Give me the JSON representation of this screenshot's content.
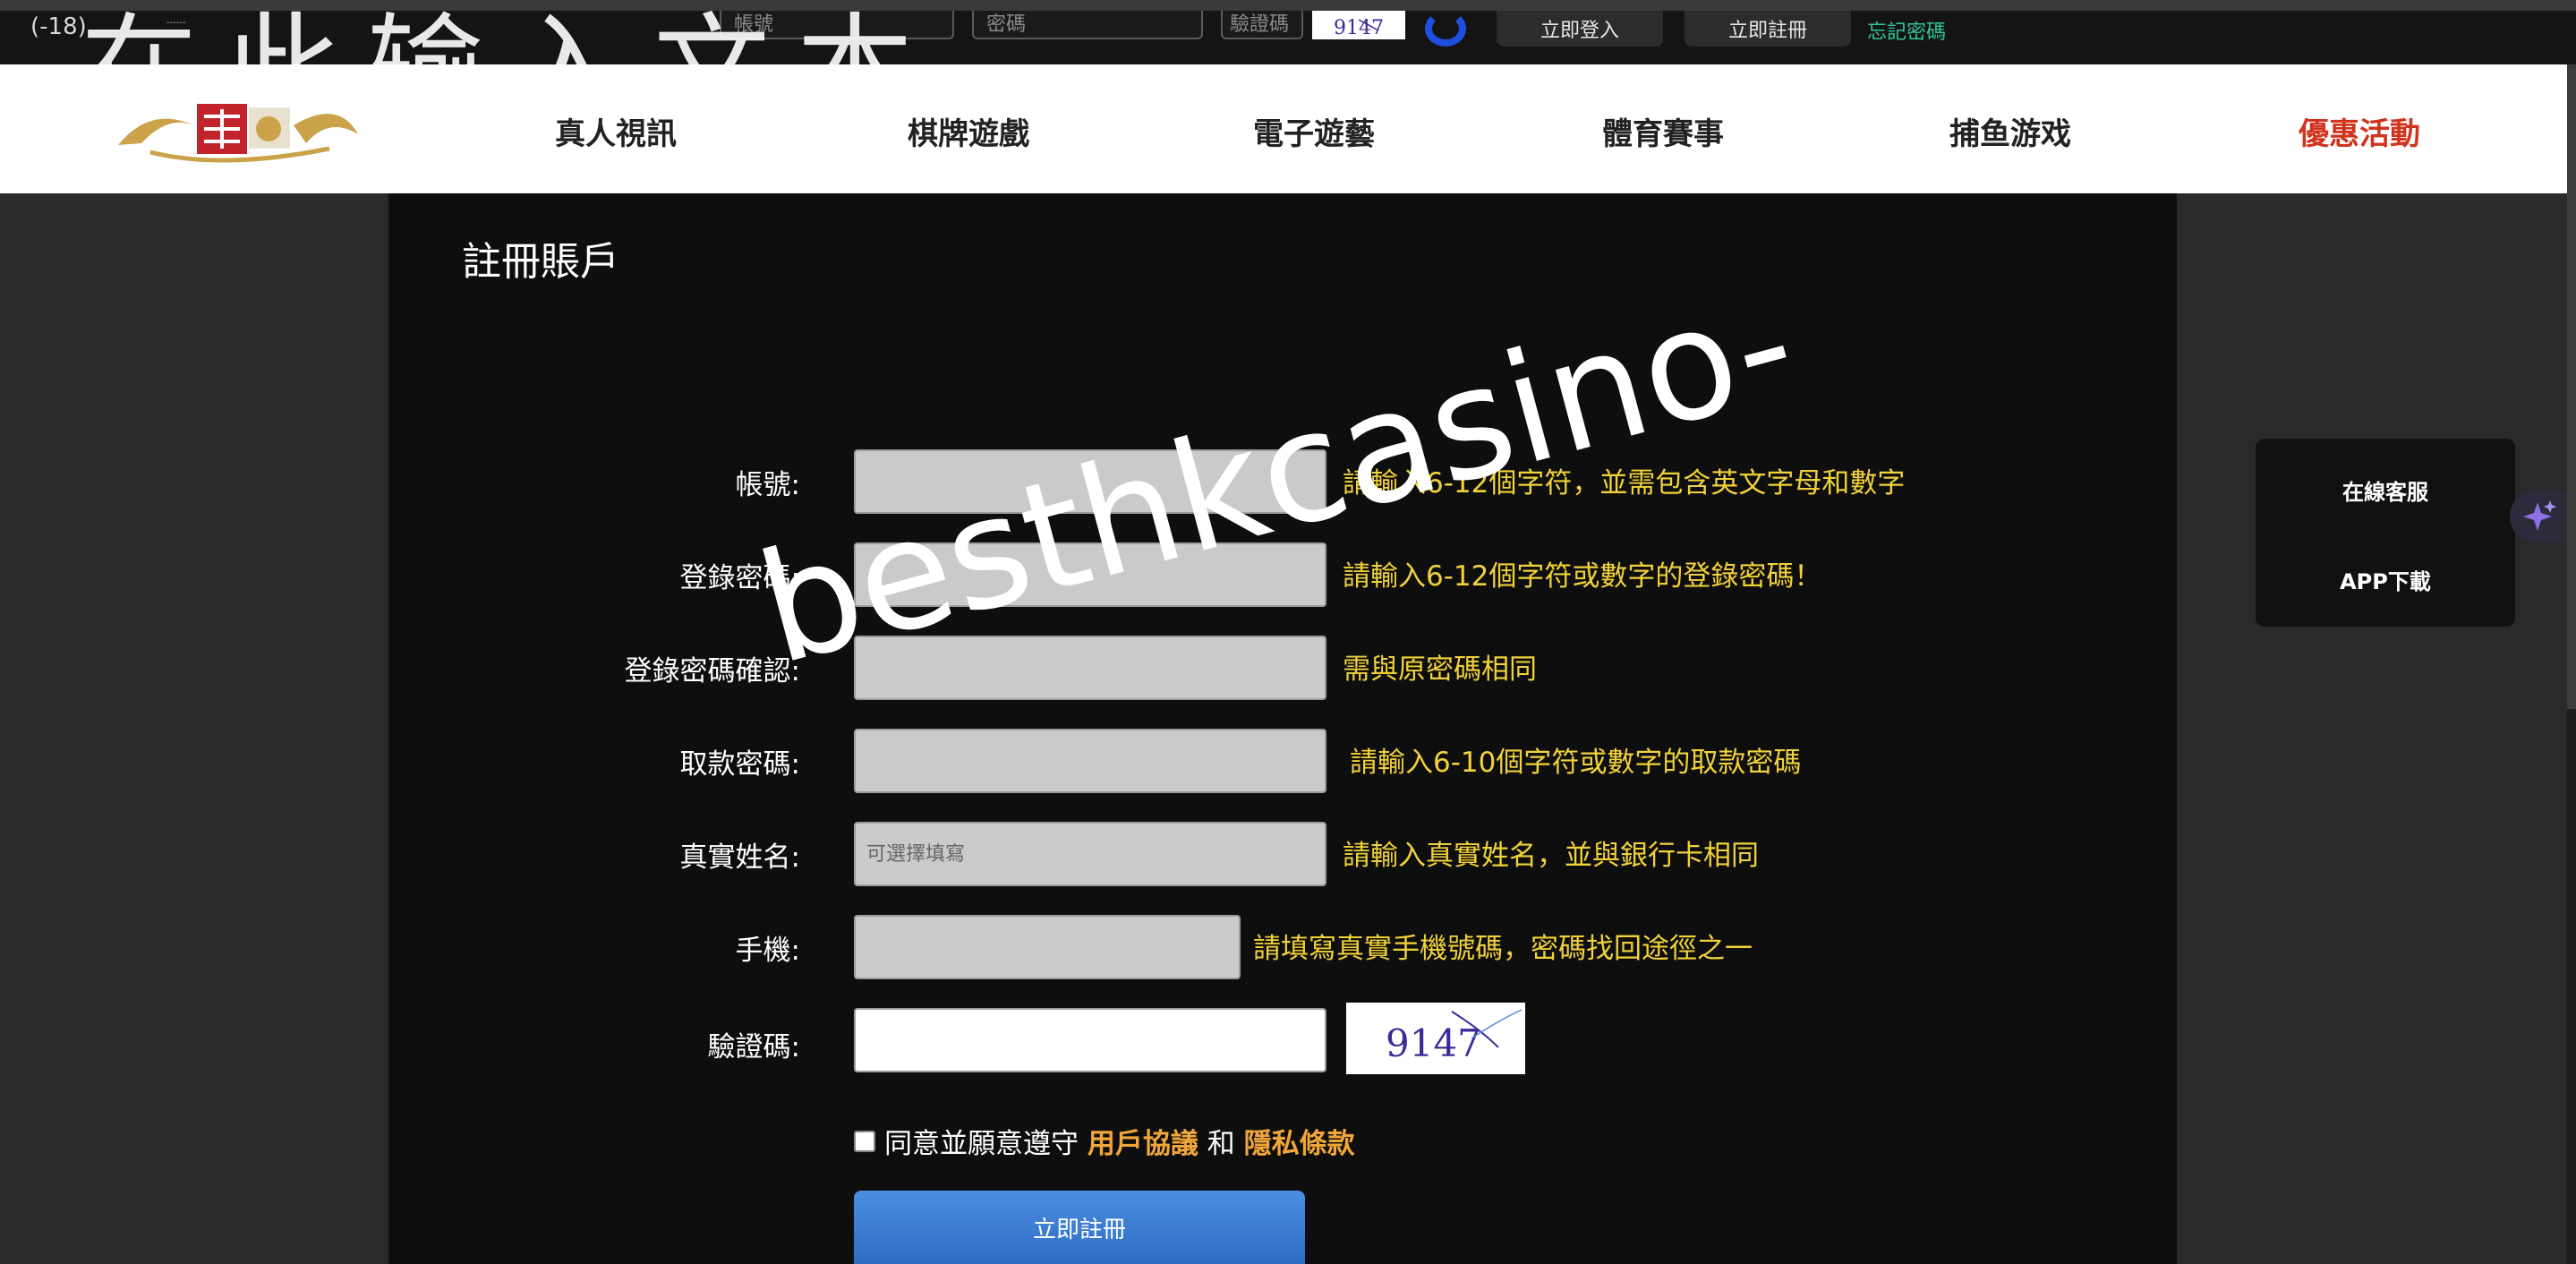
{
  "topbar": {
    "age_label": "(-18)",
    "age_sub": "------",
    "account_placeholder": "帳號",
    "password_placeholder": "密碼",
    "code_placeholder": "驗證碼",
    "captcha_text": "9147",
    "login_label": "立即登入",
    "register_label": "立即註冊",
    "forgot_label": "忘記密碼"
  },
  "overlay_text": "在此输入文本",
  "nav": {
    "items": [
      {
        "label": "真人視訊"
      },
      {
        "label": "棋牌遊戲"
      },
      {
        "label": "電子遊藝"
      },
      {
        "label": "體育賽事"
      },
      {
        "label": "捕鱼游戏"
      },
      {
        "label": "優惠活動"
      }
    ]
  },
  "form": {
    "title": "註冊賬戶",
    "rows": [
      {
        "label": "帳號:",
        "hint": "請輸入6-12個字符，並需包含英文字母和數字",
        "placeholder": ""
      },
      {
        "label": "登錄密碼:",
        "hint": "請輸入6-12個字符或數字的登錄密碼！",
        "placeholder": ""
      },
      {
        "label": "登錄密碼確認:",
        "hint": "需與原密碼相同",
        "placeholder": ""
      },
      {
        "label": "取款密碼:",
        "hint": "請輸入6-10個字符或數字的取款密碼",
        "placeholder": ""
      },
      {
        "label": "真實姓名:",
        "hint": "請輸入真實姓名，並與銀行卡相同",
        "placeholder": "可選擇填寫"
      },
      {
        "label": "手機:",
        "hint": "請填寫真實手機號碼，密碼找回途徑之一",
        "placeholder": ""
      },
      {
        "label": "驗證碼:",
        "captcha_text": "9147",
        "placeholder": ""
      }
    ],
    "agree_prefix": "同意並願意遵守",
    "agree_link1": "用戶協議",
    "agree_and": "和",
    "agree_link2": "隱私條款",
    "submit_label": "立即註冊"
  },
  "watermark": "besthkcasino-",
  "side": {
    "items": [
      {
        "label": "在線客服"
      },
      {
        "label": "APP下載"
      }
    ]
  },
  "colors": {
    "hint": "#f1d23a",
    "promo": "#d0341f",
    "link": "#f0a63a",
    "forgot": "#2fc79a",
    "submit": "#3a7dd4"
  }
}
